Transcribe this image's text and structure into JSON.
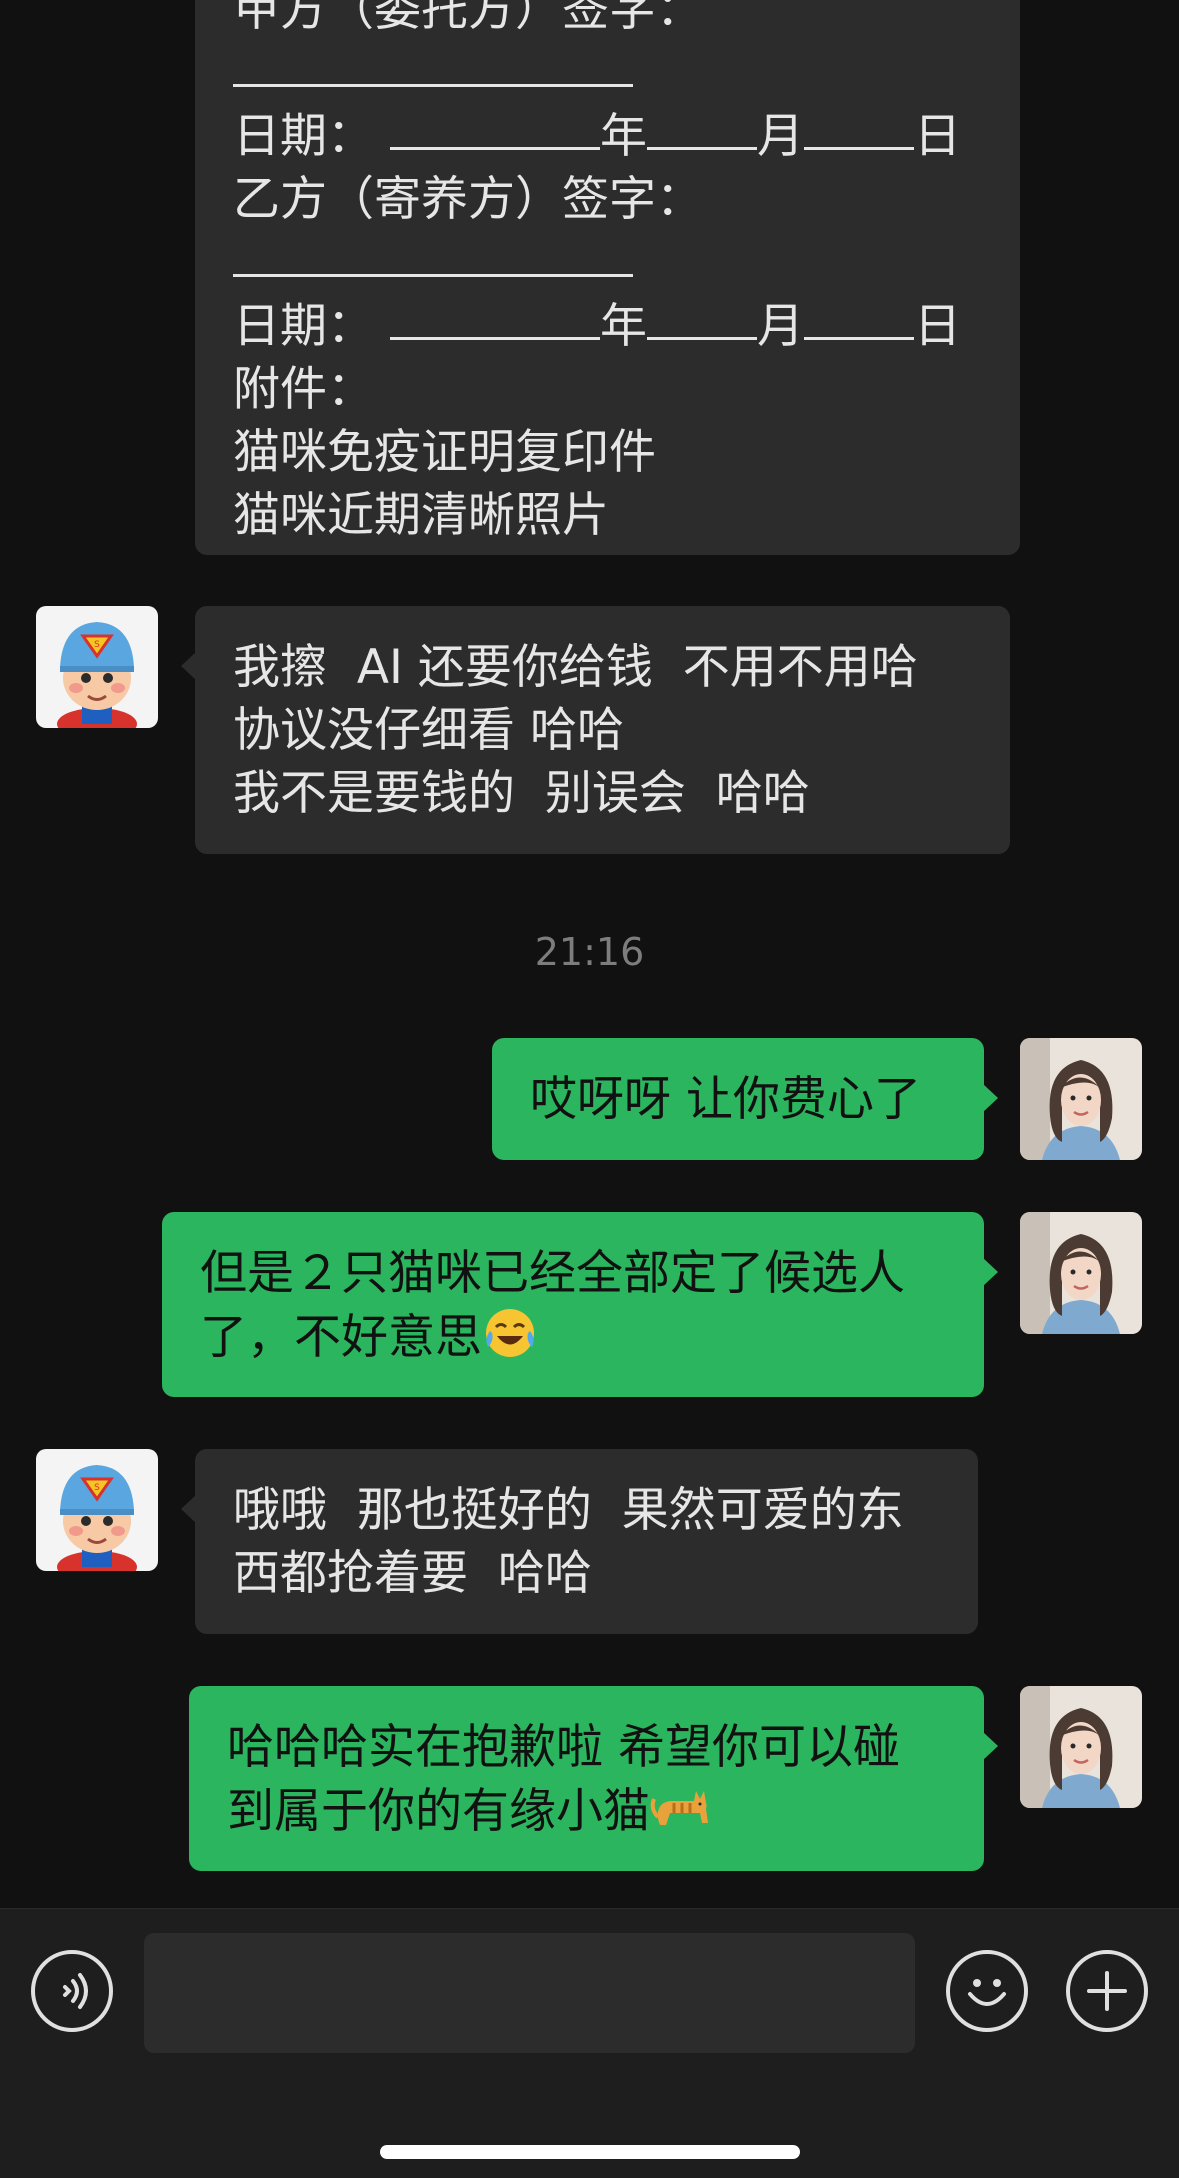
{
  "messages": {
    "contract": {
      "lines": [
        "甲方（委托方）签字：",
        "",
        "日期：",
        "乙方（寄养方）签字：",
        "",
        "日期：",
        "附件：",
        "猫咪免疫证明复印件",
        "猫咪近期清晰照片"
      ],
      "year": "年",
      "month": "月",
      "day": "日"
    },
    "m2": [
      "我擦  AI 还要你给钱  不用不用哈",
      "协议没仔细看 哈哈",
      "我不是要钱的  别误会  哈哈"
    ],
    "timestamp": "21:16",
    "m3": [
      "哎呀呀 让你费心了"
    ],
    "m4": [
      "但是２只猫咪已经全部定了候选人",
      "了，不好意思"
    ],
    "m5": [
      "哦哦  那也挺好的  果然可爱的东",
      "西都抢着要  哈哈"
    ],
    "m6": [
      "哈哈哈实在抱歉啦 希望你可以碰",
      "到属于你的有缘小猫"
    ]
  },
  "emojis": {
    "m4_end": "laughing-crying-face",
    "m6_end": "cat"
  },
  "colors": {
    "background": "#111111",
    "bubble_left": "#2c2c2c",
    "bubble_right": "#2bb55e",
    "text_left": "#e6e6e6",
    "text_right": "#111111",
    "timestamp": "#7d7d7d"
  }
}
